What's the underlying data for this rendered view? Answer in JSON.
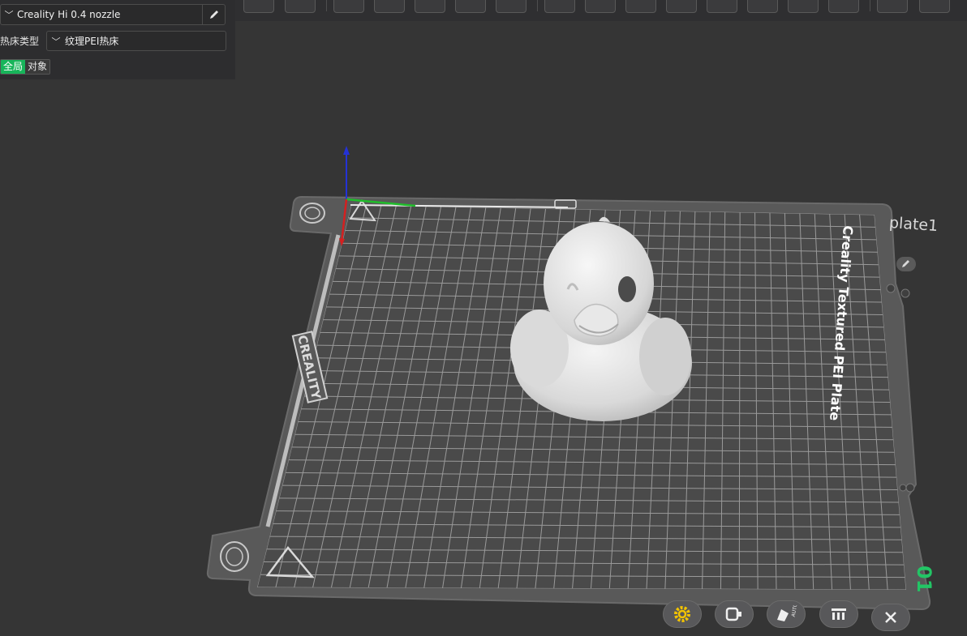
{
  "printer": {
    "nozzle_value": "Creality Hi 0.4 nozzle"
  },
  "bed": {
    "label": "热床类型",
    "value": "纹理PEI热床"
  },
  "scope": {
    "global_label": "全局",
    "object_label": "对象"
  },
  "plate": {
    "name": "plate1",
    "number": "01",
    "bed_text": "Creality Textured PEI Plate",
    "brand_text": "CREALITY"
  },
  "colors": {
    "accent": "#17b55a",
    "plate_number": "#22c565",
    "settings_icon": "#f2c300"
  },
  "icons": {
    "toolbar": [
      "box-view-icon",
      "grid-icon",
      "cut-icon",
      "shape-icon",
      "support-paint-icon",
      "arrange-icon",
      "flatten-icon",
      "layout-icon",
      "settings-group-icon",
      "measure-icon",
      "layer-icon",
      "object-icon",
      "paint-icon",
      "slice-icon",
      "text-icon",
      "emboss-icon",
      "export-icon"
    ],
    "bottom": [
      "plate-settings-icon",
      "filament-icon",
      "auto-orient-icon",
      "arrange-plate-icon",
      "delete-plate-icon"
    ]
  }
}
